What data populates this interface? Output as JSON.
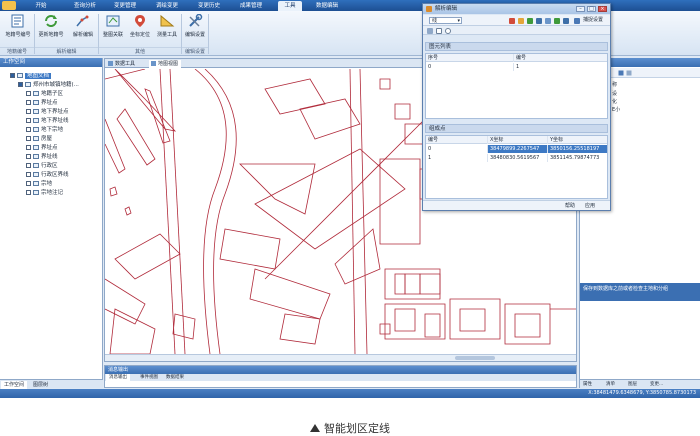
{
  "ribbon": {
    "tabs": [
      "开始",
      "查询分析",
      "变更管理",
      "调绘变更",
      "变更历史",
      "成果管理",
      "工具",
      "数据编辑"
    ],
    "active_tab": "工具",
    "buttons": [
      {
        "label": "地籍号编号"
      },
      {
        "label": "更新地籍号"
      },
      {
        "label": "解析编辑"
      },
      {
        "label": "整图关联"
      },
      {
        "label": "坐标定位"
      },
      {
        "label": "测量工具"
      },
      {
        "label": "编辑设置"
      }
    ],
    "groups": [
      "地籍编号",
      "解析编辑",
      "其他",
      "编辑设置"
    ]
  },
  "left_panel": {
    "title": "工作空间",
    "root": "地图文档",
    "dataset": "郑州市城镇地籍(...",
    "layers": [
      "地籍子区",
      "界址点",
      "地下界址点",
      "地下界址线",
      "地下宗地",
      "房屋",
      "界址点",
      "界址线",
      "行政区",
      "行政区界线",
      "宗地",
      "宗地注记"
    ],
    "tabs": [
      "工作空间",
      "图层树"
    ]
  },
  "map": {
    "doc_tabs": [
      "数据工具",
      "地图视图"
    ],
    "line_color": "#b02a3a"
  },
  "output": {
    "title": "消息输出",
    "tabs": [
      "消息输出",
      "事件视图",
      "数据结果"
    ]
  },
  "right_panel": {
    "items": [
      "称",
      "设",
      "化",
      "E小"
    ],
    "description": "保存到数据库之前或者检查主地和分组",
    "tabs": [
      "属性",
      "清单",
      "图层",
      "变更..."
    ]
  },
  "status": {
    "coords": "X:38481479.6348679,  Y:3850785.8730173"
  },
  "dialog": {
    "title": "解析编辑",
    "mode": "线",
    "snap_label": "捕捉设置",
    "sections": {
      "elements": {
        "title": "图元列表",
        "columns": [
          "序号",
          "编号"
        ],
        "rows": [
          [
            "0",
            "1"
          ]
        ]
      },
      "points": {
        "title": "组成点",
        "columns": [
          "编号",
          "X坐标",
          "Y坐标"
        ],
        "rows": [
          [
            "0",
            "38479899.2267547",
            "3850156.25518197"
          ],
          [
            "1",
            "38480830.5619567",
            "3851145.79874773"
          ]
        ]
      }
    },
    "footer": [
      "帮助",
      "应用"
    ]
  },
  "caption": {
    "text": "智能划区定线"
  }
}
